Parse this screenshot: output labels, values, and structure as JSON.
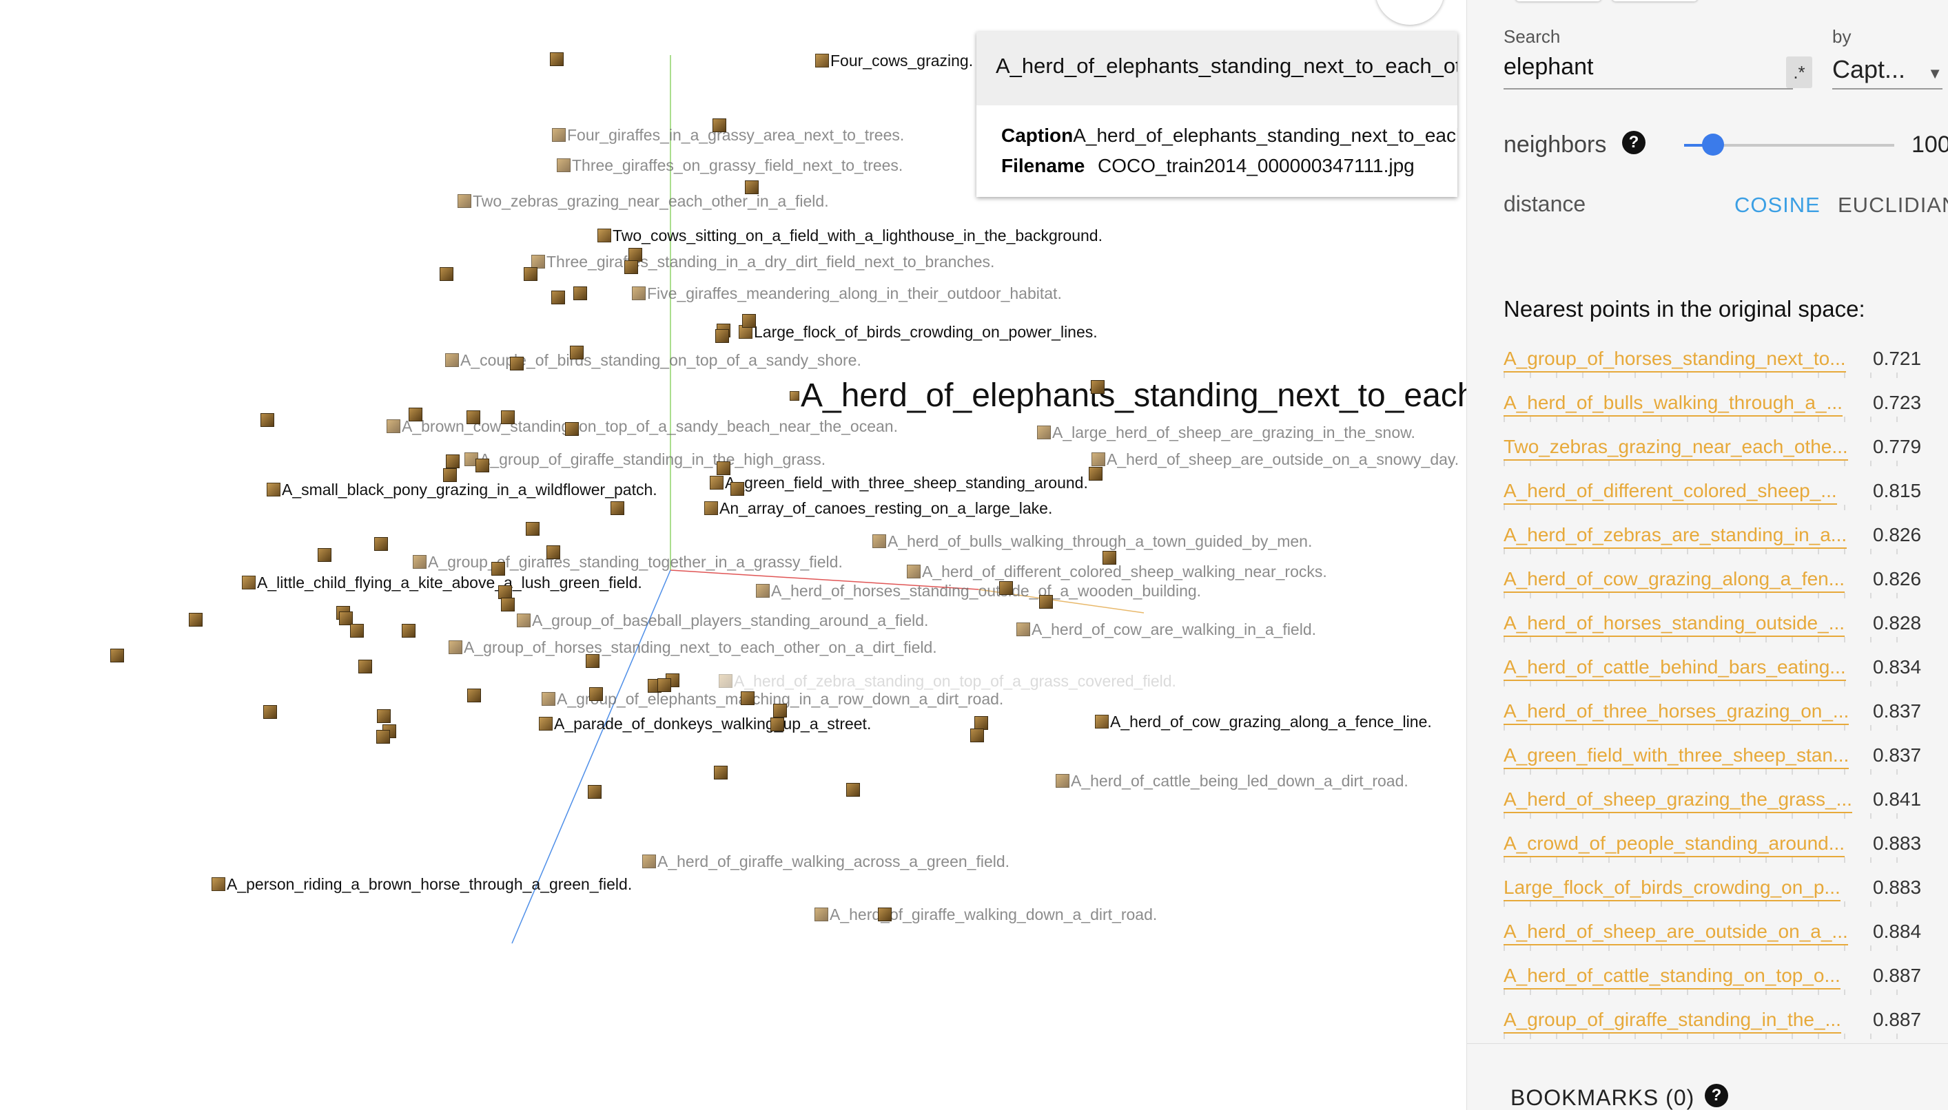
{
  "tooltip": {
    "title": "A_herd_of_elephants_standing_next_to_each_other",
    "caption_label": "Caption",
    "caption_value": "A_herd_of_elephants_standing_next_to_each_other",
    "filename_label": "Filename",
    "filename_value": "COCO_train2014_000000347111.jpg"
  },
  "points": [
    {
      "label": "Four_cows_grazing.",
      "style": "normal"
    },
    {
      "label": "Four_giraffes_in_a_grassy_area_next_to_trees.",
      "style": "faded"
    },
    {
      "label": "Three_giraffes_on_grassy_field_next_to_trees.",
      "style": "faded"
    },
    {
      "label": "Two_zebras_grazing_near_each_other_in_a_field.",
      "style": "faded"
    },
    {
      "label": "Two_cows_sitting_on_a_field_with_a_lighthouse_in_the_background.",
      "style": "normal"
    },
    {
      "label": "Three_giraffes_standing_in_a_dry_dirt_field_next_to_branches.",
      "style": "faded"
    },
    {
      "label": "Five_giraffes_meandering_along_in_their_outdoor_habitat.",
      "style": "faded"
    },
    {
      "label": "Large_flock_of_birds_crowding_on_power_lines.",
      "style": "normal"
    },
    {
      "label": "A_couple_of_birds_standing_on_top_of_a_sandy_shore.",
      "style": "faded"
    },
    {
      "label": "A_herd_of_elephants_standing_next_to_each_other",
      "style": "big"
    },
    {
      "label": "A_brown_cow_standing_on_top_of_a_sandy_beach_near_the_ocean.",
      "style": "faded"
    },
    {
      "label": "A_large_herd_of_sheep_are_grazing_in_the_snow.",
      "style": "faded"
    },
    {
      "label": "A_group_of_giraffe_standing_in_the_high_grass.",
      "style": "faded"
    },
    {
      "label": "A_herd_of_sheep_are_outside_on_a_snowy_day.",
      "style": "faded"
    },
    {
      "label": "A_small_black_pony_grazing_in_a_wildflower_patch.",
      "style": "normal"
    },
    {
      "label": "A_green_field_with_three_sheep_standing_around.",
      "style": "normal"
    },
    {
      "label": "An_array_of_canoes_resting_on_a_large_lake.",
      "style": "normal"
    },
    {
      "label": "A_herd_of_bulls_walking_through_a_town_guided_by_men.",
      "style": "faded"
    },
    {
      "label": "A_group_of_giraffes_standing_together_in_a_grassy_field.",
      "style": "faded"
    },
    {
      "label": "A_herd_of_different_colored_sheep_walking_near_rocks.",
      "style": "faded"
    },
    {
      "label": "A_little_child_flying_a_kite_above_a_lush_green_field.",
      "style": "normal"
    },
    {
      "label": "A_herd_of_horses_standing_outside_of_a_wooden_building.",
      "style": "faded"
    },
    {
      "label": "A_group_of_baseball_players_standing_around_a_field.",
      "style": "faded"
    },
    {
      "label": "A_herd_of_cow_are_walking_in_a_field.",
      "style": "faded"
    },
    {
      "label": "A_group_of_horses_standing_next_to_each_other_on_a_dirt_field.",
      "style": "faded"
    },
    {
      "label": "A_herd_of_zebra_standing_on_top_of_a_grass_covered_field.",
      "style": "faint"
    },
    {
      "label": "A_group_of_elephants_marching_in_a_row_down_a_dirt_road.",
      "style": "faded"
    },
    {
      "label": "A_parade_of_donkeys_walking_up_a_street.",
      "style": "normal"
    },
    {
      "label": "A_herd_of_cow_grazing_along_a_fence_line.",
      "style": "normal"
    },
    {
      "label": "A_herd_of_cattle_being_led_down_a_dirt_road.",
      "style": "faded"
    },
    {
      "label": "A_herd_of_giraffe_walking_across_a_green_field.",
      "style": "faded"
    },
    {
      "label": "A_person_riding_a_brown_horse_through_a_green_field.",
      "style": "normal"
    },
    {
      "label": "A_herd_of_giraffe_walking_down_a_dirt_road.",
      "style": "faded"
    }
  ],
  "panel": {
    "search_label": "Search",
    "search_value": "elephant",
    "regex_label": ".*",
    "by_label": "by",
    "by_value": "Capt...",
    "neighbors_label": "neighbors",
    "neighbors_value": "100",
    "distance_label": "distance",
    "cosine_label": "COSINE",
    "euclidean_label": "EUCLIDIAN",
    "nearest_title": "Nearest points in the original space:",
    "nearest": [
      {
        "name": "A_group_of_horses_standing_next_to...",
        "dist": "0.721"
      },
      {
        "name": "A_herd_of_bulls_walking_through_a_...",
        "dist": "0.723"
      },
      {
        "name": "Two_zebras_grazing_near_each_othe...",
        "dist": "0.779"
      },
      {
        "name": "A_herd_of_different_colored_sheep_...",
        "dist": "0.815"
      },
      {
        "name": "A_herd_of_zebras_are_standing_in_a...",
        "dist": "0.826"
      },
      {
        "name": "A_herd_of_cow_grazing_along_a_fen...",
        "dist": "0.826"
      },
      {
        "name": "A_herd_of_horses_standing_outside_...",
        "dist": "0.828"
      },
      {
        "name": "A_herd_of_cattle_behind_bars_eating...",
        "dist": "0.834"
      },
      {
        "name": "A_herd_of_three_horses_grazing_on_...",
        "dist": "0.837"
      },
      {
        "name": "A_green_field_with_three_sheep_stan...",
        "dist": "0.837"
      },
      {
        "name": "A_herd_of_sheep_grazing_the_grass_...",
        "dist": "0.841"
      },
      {
        "name": "A_crowd_of_people_standing_around...",
        "dist": "0.883"
      },
      {
        "name": "Large_flock_of_birds_crowding_on_p...",
        "dist": "0.883"
      },
      {
        "name": "A_herd_of_sheep_are_outside_on_a_...",
        "dist": "0.884"
      },
      {
        "name": "A_herd_of_cattle_standing_on_top_o...",
        "dist": "0.887"
      },
      {
        "name": "A_group_of_giraffe_standing_in_the_...",
        "dist": "0.887"
      }
    ],
    "bookmarks_label": "BOOKMARKS (0)"
  },
  "colors": {
    "accent": "#3b7bea",
    "link": "#e7a93a",
    "cosine": "#3b9fe4",
    "axis_x": "#e05555",
    "axis_y": "#8fd46a",
    "axis_z": "#4f8fe8"
  }
}
